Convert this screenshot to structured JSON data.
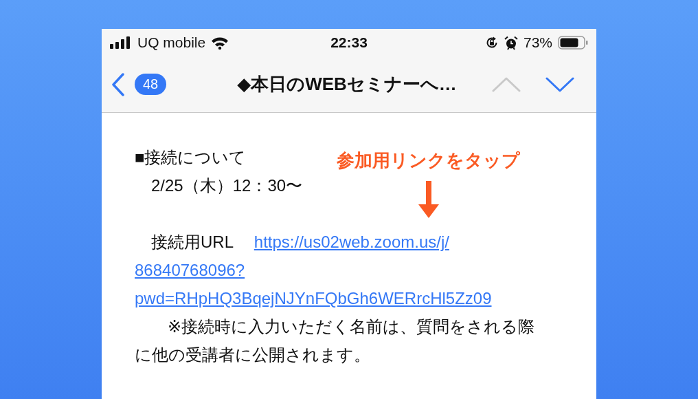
{
  "status_bar": {
    "carrier": "UQ mobile",
    "time": "22:33",
    "battery": "73%"
  },
  "nav": {
    "unread_count": "48",
    "title": "◆本日のWEBセミナーへ…",
    "previous_enabled": false,
    "next_enabled": true
  },
  "message": {
    "section_title": "■接続について",
    "schedule": "　2/25（木）12：30〜",
    "url_label": "　接続用URL　",
    "url_lines": [
      "https://us02web.zoom.us/j/",
      "86840768096?",
      "pwd=RHpHQ3BqejNJYnFQbGh6WERrcHl5Zz09"
    ],
    "note": "　　※接続時に入力いただく名前は、質問をされる際に他の受講者に公開されます。"
  },
  "annotation": {
    "text": "参加用リンクをタップ"
  }
}
